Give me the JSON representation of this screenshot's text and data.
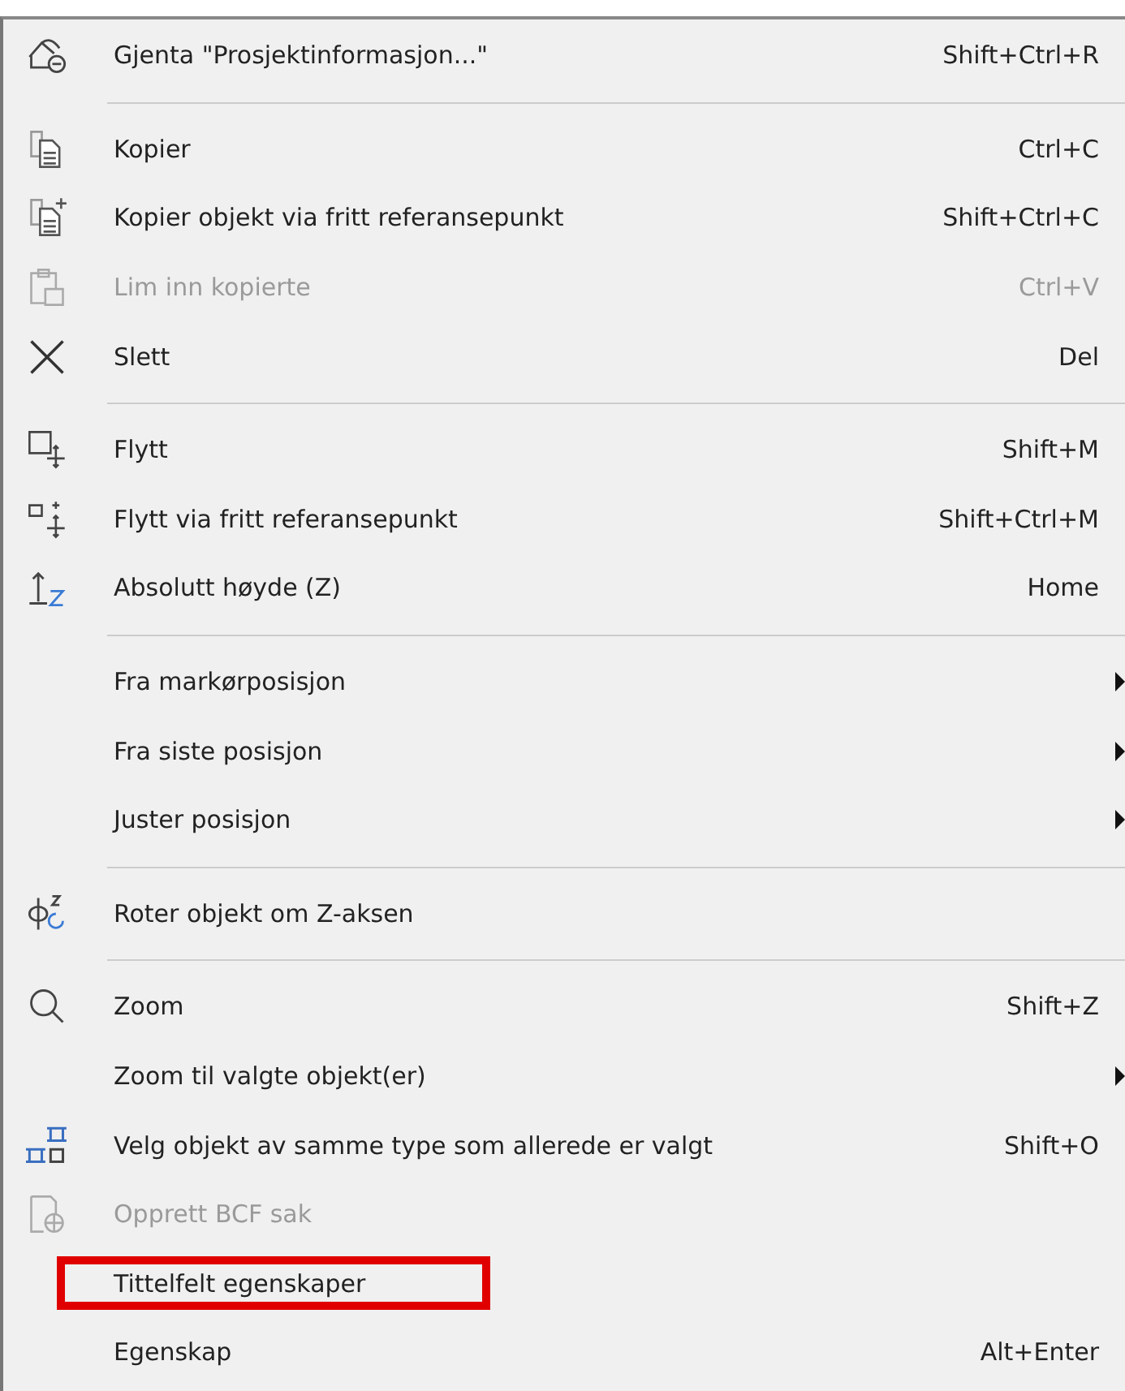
{
  "menu": {
    "groups": [
      {
        "items": [
          {
            "label": "Gjenta \"Prosjektinformasjon...\"",
            "shortcut": "Shift+Ctrl+R",
            "kind": "repeat",
            "disabled": false,
            "submenu": false,
            "highlighted": false
          }
        ]
      },
      {
        "items": [
          {
            "label": "Kopier",
            "shortcut": "Ctrl+C",
            "kind": "copy",
            "disabled": false,
            "submenu": false,
            "highlighted": false
          },
          {
            "label": "Kopier objekt via fritt referansepunkt",
            "shortcut": "Shift+Ctrl+C",
            "kind": "copyref",
            "disabled": false,
            "submenu": false,
            "highlighted": false
          },
          {
            "label": "Lim inn kopierte",
            "shortcut": "Ctrl+V",
            "kind": "paste",
            "disabled": true,
            "submenu": false,
            "highlighted": false
          },
          {
            "label": "Slett",
            "shortcut": "Del",
            "kind": "delete",
            "disabled": false,
            "submenu": false,
            "highlighted": false
          }
        ]
      },
      {
        "items": [
          {
            "label": "Flytt",
            "shortcut": "Shift+M",
            "kind": "move",
            "disabled": false,
            "submenu": false,
            "highlighted": false
          },
          {
            "label": "Flytt via fritt referansepunkt",
            "shortcut": "Shift+Ctrl+M",
            "kind": "moveref",
            "disabled": false,
            "submenu": false,
            "highlighted": false
          },
          {
            "label": "Absolutt høyde (Z)",
            "shortcut": "Home",
            "kind": "height",
            "disabled": false,
            "submenu": false,
            "highlighted": false
          }
        ]
      },
      {
        "items": [
          {
            "label": "Fra markørposisjon",
            "disabled": false,
            "submenu": true,
            "highlighted": false
          },
          {
            "label": "Fra siste posisjon",
            "disabled": false,
            "submenu": true,
            "highlighted": false
          },
          {
            "label": "Juster posisjon",
            "disabled": false,
            "submenu": true,
            "highlighted": false
          }
        ]
      },
      {
        "items": [
          {
            "label": "Roter objekt om Z-aksen",
            "kind": "rotate",
            "disabled": false,
            "submenu": false,
            "highlighted": false
          }
        ]
      },
      {
        "items": [
          {
            "label": "Zoom",
            "shortcut": "Shift+Z",
            "kind": "zoom",
            "disabled": false,
            "submenu": false,
            "highlighted": false
          },
          {
            "label": "Zoom til valgte objekt(er)",
            "disabled": false,
            "submenu": true,
            "highlighted": false
          },
          {
            "label": "Velg objekt av samme type som allerede er valgt",
            "shortcut": "Shift+O",
            "kind": "selectsame",
            "disabled": false,
            "submenu": false,
            "highlighted": false
          },
          {
            "label": "Opprett BCF sak",
            "kind": "bcf",
            "disabled": true,
            "submenu": false,
            "highlighted": false
          },
          {
            "label": "Tittelfelt egenskaper",
            "disabled": false,
            "submenu": false,
            "highlighted": true
          },
          {
            "label": "Egenskap",
            "shortcut": "Alt+Enter",
            "disabled": false,
            "submenu": false,
            "highlighted": false
          }
        ]
      }
    ]
  }
}
